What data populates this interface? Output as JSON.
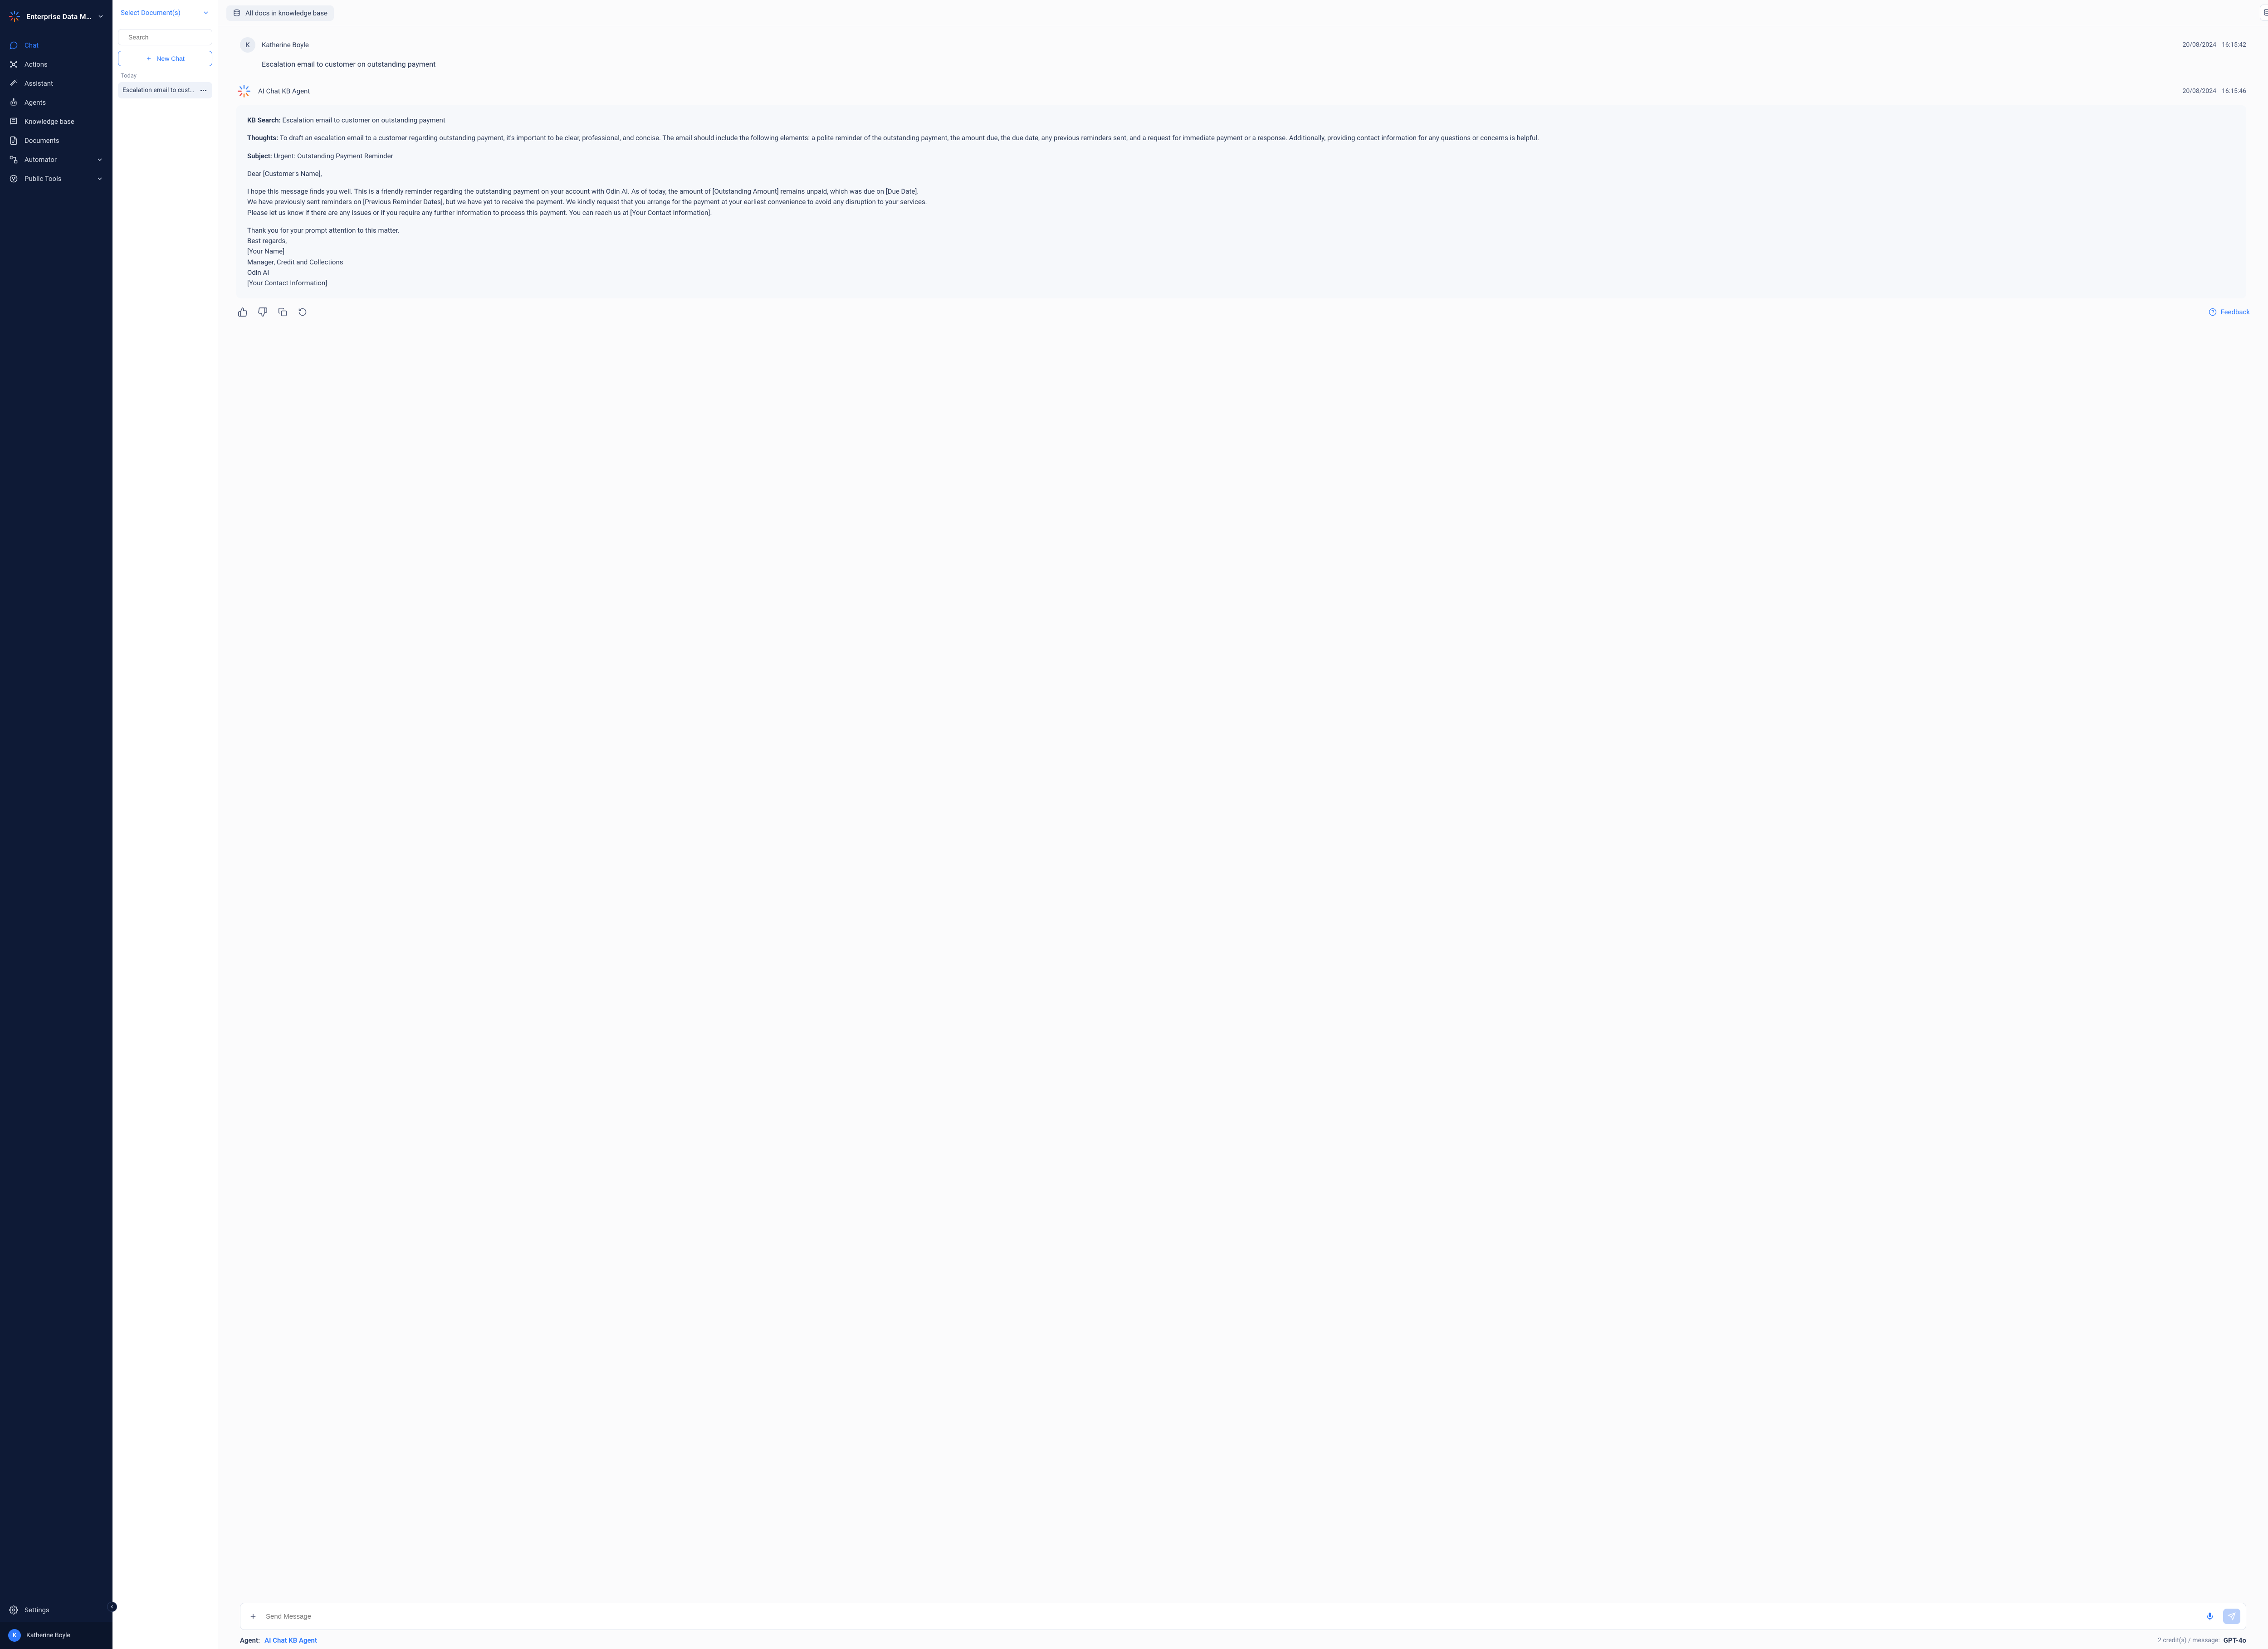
{
  "brand": {
    "name": "Enterprise Data Mana.."
  },
  "nav": {
    "chat": "Chat",
    "actions": "Actions",
    "assistant": "Assistant",
    "agents": "Agents",
    "knowledge_base": "Knowledge base",
    "documents": "Documents",
    "automator": "Automator",
    "public_tools": "Public Tools",
    "settings": "Settings"
  },
  "user": {
    "initial": "K",
    "name": "Katherine Boyle"
  },
  "chat_panel": {
    "select_docs": "Select Document(s)",
    "search_placeholder": "Search",
    "new_chat": "New Chat",
    "today_label": "Today",
    "items": [
      {
        "title": "Escalation email to custo..."
      }
    ]
  },
  "chip": {
    "label": "All docs in knowledge base"
  },
  "user_message": {
    "avatar": "K",
    "name": "Katherine Boyle",
    "date": "20/08/2024",
    "time": "16:15:42",
    "text": "Escalation email to customer on outstanding payment"
  },
  "agent_message": {
    "name": "AI Chat KB Agent",
    "date": "20/08/2024",
    "time": "16:15:46",
    "kb_label": "KB Search:",
    "kb_value": "Escalation email to customer on outstanding payment",
    "thoughts_label": "Thoughts:",
    "thoughts_value": "To draft an escalation email to a customer regarding outstanding payment, it's important to be clear, professional, and concise. The email should include the following elements: a polite reminder of the outstanding payment, the amount due, the due date, any previous reminders sent, and a request for immediate payment or a response. Additionally, providing contact information for any questions or concerns is helpful.",
    "subject_label": "Subject:",
    "subject_value": "Urgent: Outstanding Payment Reminder",
    "greeting": "Dear [Customer's Name],",
    "p1": "I hope this message finds you well. This is a friendly reminder regarding the outstanding payment on your account with Odin AI. As of today, the amount of [Outstanding Amount] remains unpaid, which was due on [Due Date].",
    "p2": "We have previously sent reminders on [Previous Reminder Dates], but we have yet to receive the payment. We kindly request that you arrange for the payment at your earliest convenience to avoid any disruption to your services.",
    "p3": "Please let us know if there are any issues or if you require any further information to process this payment. You can reach us at [Your Contact Information].",
    "c1": "Thank you for your prompt attention to this matter.",
    "c2": "Best regards,",
    "c3": "[Your Name]",
    "c4": "Manager, Credit and Collections",
    "c5": "Odin AI",
    "c6": "[Your Contact Information]"
  },
  "feedback_label": "Feedback",
  "composer": {
    "placeholder": "Send Message"
  },
  "status": {
    "agent_label": "Agent:",
    "agent_name": "AI Chat KB Agent",
    "credits": "2 credit(s) / message:",
    "model": "GPT-4o"
  }
}
